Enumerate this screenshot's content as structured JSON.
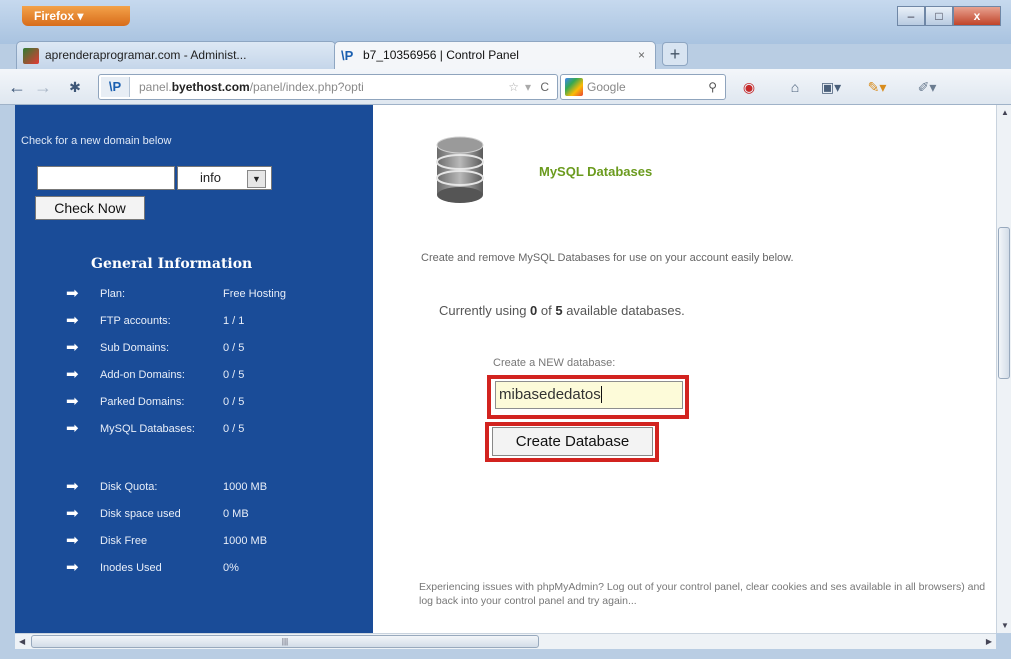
{
  "browser": {
    "menu_label": "Firefox",
    "window_controls": {
      "minimize": "–",
      "maximize": "□",
      "close": "x"
    },
    "tabs": [
      {
        "label": "aprenderaprogramar.com - Administ...",
        "active": false
      },
      {
        "label": "b7_10356956 | Control Panel",
        "active": true
      }
    ],
    "tab_close": "×",
    "new_tab": "+",
    "nav": {
      "back": "←",
      "forward": "→",
      "reload": "C"
    },
    "url": {
      "prefix": "panel.",
      "domain": "byethost.com",
      "path": "/panel/index.php?opti"
    },
    "search_placeholder": "Google"
  },
  "sidebar": {
    "domain_check_label": "Check for a new domain below",
    "domain_input_value": "",
    "tld_value": "info",
    "check_button": "Check Now",
    "general_info_title": "General Information",
    "items": [
      {
        "label": "Plan:",
        "value": "Free Hosting"
      },
      {
        "label": "FTP accounts:",
        "value": "1 / 1"
      },
      {
        "label": "Sub Domains:",
        "value": "0 / 5"
      },
      {
        "label": "Add-on Domains:",
        "value": "0 / 5"
      },
      {
        "label": "Parked Domains:",
        "value": "0 / 5"
      },
      {
        "label": "MySQL Databases:",
        "value": "0 / 5"
      }
    ],
    "disk_items": [
      {
        "label": "Disk Quota:",
        "value": "1000 MB"
      },
      {
        "label": "Disk space used",
        "value": "0 MB"
      },
      {
        "label": "Disk Free",
        "value": "1000 MB"
      },
      {
        "label": "Inodes Used",
        "value": "0%"
      }
    ]
  },
  "main": {
    "section_title": "MySQL Databases",
    "description": "Create and remove MySQL Databases for use on your account easily below.",
    "usage": {
      "prefix": "Currently using ",
      "used": "0",
      "mid": " of ",
      "total": "5",
      "suffix": " available databases."
    },
    "new_db_label": "Create a NEW database:",
    "new_db_value": "mibasededatos",
    "create_button": "Create Database",
    "note": "Experiencing issues with phpMyAdmin? Log out of your control panel, clear cookies and ses available in all browsers) and log back into your control panel and try again..."
  },
  "colors": {
    "sidebar_bg": "#1a4c98",
    "title_green": "#6b9b1e",
    "highlight_red": "#d2231f"
  }
}
